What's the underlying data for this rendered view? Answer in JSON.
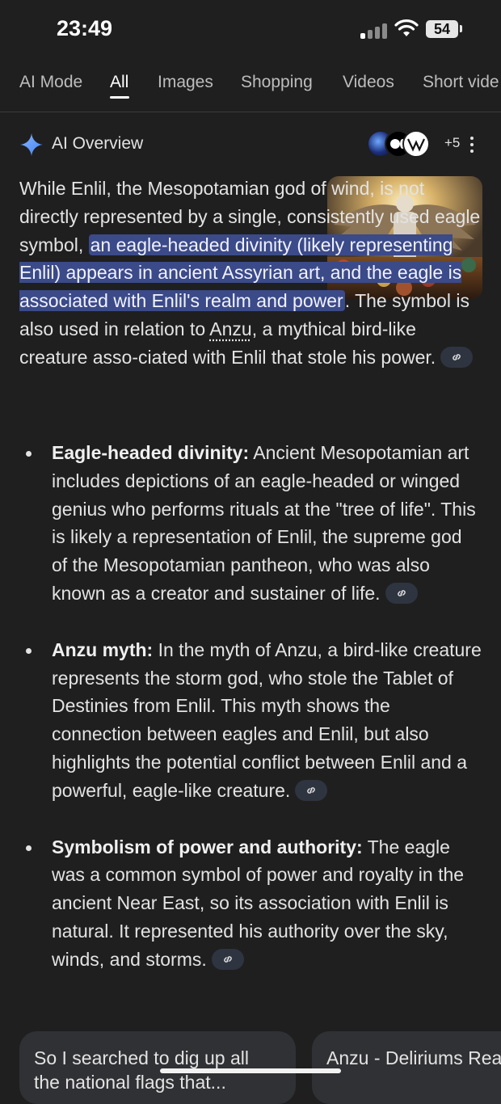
{
  "status_bar": {
    "time": "23:49",
    "battery": "54"
  },
  "tabs": [
    "AI Mode",
    "All",
    "Images",
    "Shopping",
    "Videos",
    "Short vide"
  ],
  "ai_overview": {
    "title": "AI Overview",
    "sources_count": "+5",
    "source_icons": [
      "source-globe-icon",
      "medium-logo-icon",
      "wikipedia-logo-icon"
    ],
    "accent_color": "#3b4a88",
    "paragraph": {
      "p1": "While Enlil, the Mesopotamian god of wind, is not directly represented by a single, consistently used eagle symbol, ",
      "highlight": "an eagle-headed divinity (likely representing Enlil) appears in ancient Assyrian art, and the eagle is associated with Enlil's realm and power",
      "p2": ". The symbol is also used in relation to ",
      "term": "Anzu",
      "p3": ", a mythical bird-like creature asso-ciated with Enlil that stole his power."
    },
    "bullets": [
      {
        "title": "Eagle-headed divinity:",
        "text": " Ancient Mesopotamian art includes depictions of an eagle-headed or winged genius who performs rituals at the \"tree of life\". This is likely a representation of Enlil, the supreme god of the Mesopotamian pantheon, who was also known as a creator and sustainer of life."
      },
      {
        "title": "Anzu myth:",
        "text": " In the myth of Anzu, a bird-like creature represents the storm god, who stole the Tablet of Destinies from Enlil. This myth shows the connection between eagles and Enlil, but also highlights the potential conflict between Enlil and a powerful, eagle-like creature."
      },
      {
        "title": "Symbolism of power and authority:",
        "text": " The eagle was a common symbol of power and royalty in the ancient Near East, so its association with Enlil is natural. It represented his authority over the sky, winds, and storms."
      }
    ]
  },
  "cards": [
    {
      "text": "So I searched to dig up all the national flags that..."
    },
    {
      "text": "Anzu - Deliriums Rea"
    }
  ]
}
